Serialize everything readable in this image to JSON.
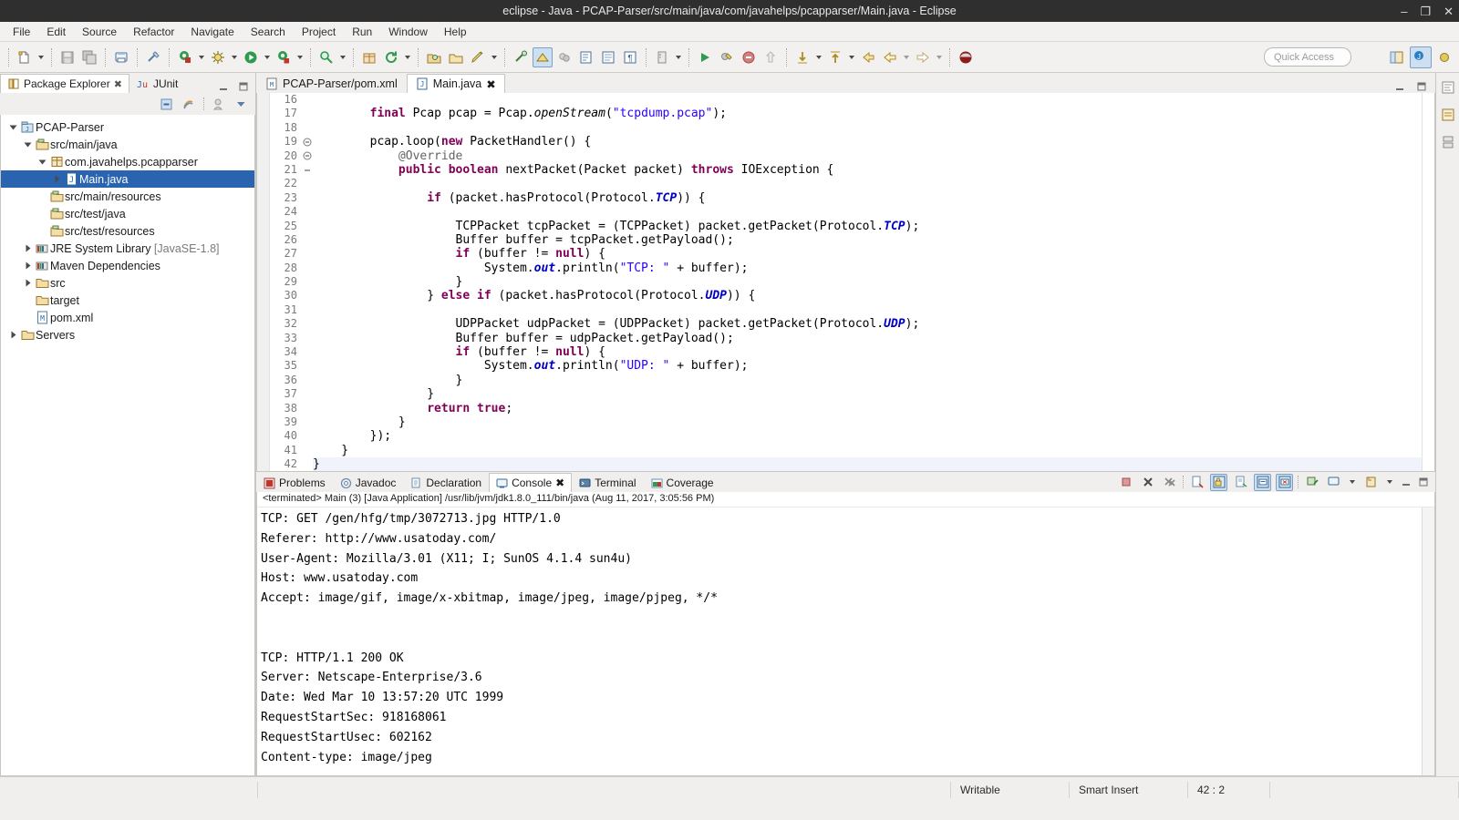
{
  "window": {
    "title": "eclipse - Java - PCAP-Parser/src/main/java/com/javahelps/pcapparser/Main.java - Eclipse",
    "minimize_label": "–",
    "maximize_label": "❐",
    "close_label": "✕"
  },
  "menubar": {
    "items": [
      {
        "label": "File"
      },
      {
        "label": "Edit"
      },
      {
        "label": "Source"
      },
      {
        "label": "Refactor"
      },
      {
        "label": "Navigate"
      },
      {
        "label": "Search"
      },
      {
        "label": "Project"
      },
      {
        "label": "Run"
      },
      {
        "label": "Window"
      },
      {
        "label": "Help"
      }
    ]
  },
  "toolbar": {
    "quick_access_placeholder": "Quick Access",
    "buttons": [
      {
        "name": "new-wizard",
        "icon": "new-file-icon"
      },
      {
        "name": "save",
        "icon": "save-icon"
      },
      {
        "name": "save-all",
        "icon": "save-all-icon"
      },
      {
        "name": "print",
        "icon": "print-icon"
      },
      {
        "name": "link-editor",
        "icon": "link-icon"
      },
      {
        "name": "new-java-class",
        "icon": "java-class-icon"
      },
      {
        "name": "debug",
        "icon": "debug-icon"
      },
      {
        "name": "run",
        "icon": "run-icon"
      },
      {
        "name": "run-external-tools",
        "icon": "external-tools-icon"
      },
      {
        "name": "search",
        "icon": "search-icon"
      },
      {
        "name": "new-package",
        "icon": "package-icon"
      },
      {
        "name": "refresh",
        "icon": "refresh-icon"
      },
      {
        "name": "open-type",
        "icon": "open-type-icon"
      },
      {
        "name": "open-task",
        "icon": "open-task-icon"
      },
      {
        "name": "annotation",
        "icon": "pencil-icon"
      },
      {
        "name": "toggle-mark-occurrences",
        "icon": "mark-occurrences-icon"
      },
      {
        "name": "toggle-breadcrumb",
        "icon": "breadcrumb-icon"
      },
      {
        "name": "coverage",
        "icon": "coverage-icon"
      },
      {
        "name": "next-annotation",
        "icon": "next-annotation-icon"
      },
      {
        "name": "previous-annotation",
        "icon": "previous-annotation-icon"
      },
      {
        "name": "last-edit-location",
        "icon": "last-edit-icon"
      },
      {
        "name": "back",
        "icon": "back-arrow-icon"
      },
      {
        "name": "forward",
        "icon": "forward-arrow-icon"
      },
      {
        "name": "terminate",
        "icon": "terminate-icon"
      }
    ],
    "perspectives": [
      {
        "name": "open-perspective",
        "icon": "open-perspective-icon"
      },
      {
        "name": "perspective-java",
        "icon": "java-perspective-icon",
        "selected": true
      },
      {
        "name": "perspective-debug",
        "icon": "debug-perspective-icon",
        "selected": false
      }
    ]
  },
  "package_explorer": {
    "tabs": [
      {
        "label": "Package Explorer",
        "icon": "package-explorer-icon",
        "selected": true,
        "closeable": true
      },
      {
        "label": "JUnit",
        "icon": "junit-icon",
        "selected": false,
        "closeable": false
      }
    ],
    "view_buttons": [
      {
        "name": "minimize-view-button",
        "icon": "minimize-icon"
      },
      {
        "name": "maximize-view-button",
        "icon": "maximize-icon"
      }
    ],
    "toolbar_buttons": [
      {
        "name": "collapse-all-button",
        "icon": "collapse-all-icon"
      },
      {
        "name": "link-with-editor-button",
        "icon": "link-with-editor-icon"
      },
      {
        "name": "focus-on-active-task-button",
        "icon": "focus-task-icon"
      },
      {
        "name": "view-menu-button",
        "icon": "view-menu-icon"
      }
    ],
    "tree": [
      {
        "label": "PCAP-Parser",
        "indent": 0,
        "twist": "open",
        "icon": "java-project-icon",
        "selected": false
      },
      {
        "label": "src/main/java",
        "indent": 1,
        "twist": "open",
        "icon": "source-folder-icon",
        "selected": false
      },
      {
        "label": "com.javahelps.pcapparser",
        "indent": 2,
        "twist": "open",
        "icon": "package-icon",
        "selected": false
      },
      {
        "label": "Main.java",
        "indent": 3,
        "twist": "closed",
        "icon": "java-file-icon",
        "selected": true
      },
      {
        "label": "src/main/resources",
        "indent": 2,
        "twist": "none",
        "icon": "source-folder-icon",
        "selected": false
      },
      {
        "label": "src/test/java",
        "indent": 2,
        "twist": "none",
        "icon": "source-folder-icon",
        "selected": false
      },
      {
        "label": "src/test/resources",
        "indent": 2,
        "twist": "none",
        "icon": "source-folder-icon",
        "selected": false
      },
      {
        "label": "JRE System Library",
        "suffix": "[JavaSE-1.8]",
        "indent": 1,
        "twist": "closed",
        "icon": "library-icon",
        "selected": false
      },
      {
        "label": "Maven Dependencies",
        "indent": 1,
        "twist": "closed",
        "icon": "library-icon",
        "selected": false
      },
      {
        "label": "src",
        "indent": 1,
        "twist": "closed",
        "icon": "folder-icon",
        "selected": false
      },
      {
        "label": "target",
        "indent": 1,
        "twist": "none",
        "icon": "folder-icon",
        "selected": false
      },
      {
        "label": "pom.xml",
        "indent": 1,
        "twist": "none",
        "icon": "xml-file-icon",
        "selected": false
      },
      {
        "label": "Servers",
        "indent": 0,
        "twist": "closed",
        "icon": "folder-icon",
        "selected": false
      }
    ]
  },
  "editor": {
    "tabs": [
      {
        "label": "PCAP-Parser/pom.xml",
        "icon": "xml-file-icon",
        "selected": false,
        "closeable": false
      },
      {
        "label": "Main.java",
        "icon": "java-file-icon",
        "selected": true,
        "closeable": true
      }
    ],
    "tab_buttons": [
      {
        "name": "minimize-editor-button",
        "icon": "minimize-icon"
      },
      {
        "name": "maximize-editor-button",
        "icon": "maximize-icon"
      }
    ],
    "first_line": 16,
    "lines": [
      {
        "n": 16,
        "fold": "",
        "text": ""
      },
      {
        "n": 17,
        "fold": "",
        "html": "        <span class=\"kw\">final</span> Pcap pcap = Pcap.<span class=\"stat\">openStream</span>(<span class=\"str\">\"tcpdump.pcap\"</span>);"
      },
      {
        "n": 18,
        "fold": "",
        "text": ""
      },
      {
        "n": 19,
        "fold": "minus",
        "html": "        pcap.loop(<span class=\"kw\">new</span> PacketHandler() {"
      },
      {
        "n": 20,
        "fold": "minus",
        "html": "            <span class=\"ann\">@Override</span>"
      },
      {
        "n": 21,
        "fold": "dash",
        "html": "            <span class=\"kw\">public</span> <span class=\"kw\">boolean</span> nextPacket(Packet packet) <span class=\"kw\">throws</span> IOException {"
      },
      {
        "n": 22,
        "fold": "",
        "text": ""
      },
      {
        "n": 23,
        "fold": "",
        "html": "                <span class=\"kw\">if</span> (packet.hasProtocol(Protocol.<span class=\"statb\">TCP</span>)) {"
      },
      {
        "n": 24,
        "fold": "",
        "text": ""
      },
      {
        "n": 25,
        "fold": "",
        "html": "                    TCPPacket tcpPacket = (TCPPacket) packet.getPacket(Protocol.<span class=\"statb\">TCP</span>);"
      },
      {
        "n": 26,
        "fold": "",
        "html": "                    Buffer buffer = tcpPacket.getPayload();"
      },
      {
        "n": 27,
        "fold": "",
        "html": "                    <span class=\"kw\">if</span> (buffer != <span class=\"kw\">null</span>) {"
      },
      {
        "n": 28,
        "fold": "",
        "html": "                        System.<span class=\"statb\">out</span>.println(<span class=\"str\">\"TCP: \"</span> + buffer);"
      },
      {
        "n": 29,
        "fold": "",
        "html": "                    }"
      },
      {
        "n": 30,
        "fold": "",
        "html": "                } <span class=\"kw\">else</span> <span class=\"kw\">if</span> (packet.hasProtocol(Protocol.<span class=\"statb\">UDP</span>)) {"
      },
      {
        "n": 31,
        "fold": "",
        "text": ""
      },
      {
        "n": 32,
        "fold": "",
        "html": "                    UDPPacket udpPacket = (UDPPacket) packet.getPacket(Protocol.<span class=\"statb\">UDP</span>);"
      },
      {
        "n": 33,
        "fold": "",
        "html": "                    Buffer buffer = udpPacket.getPayload();"
      },
      {
        "n": 34,
        "fold": "",
        "html": "                    <span class=\"kw\">if</span> (buffer != <span class=\"kw\">null</span>) {"
      },
      {
        "n": 35,
        "fold": "",
        "html": "                        System.<span class=\"statb\">out</span>.println(<span class=\"str\">\"UDP: \"</span> + buffer);"
      },
      {
        "n": 36,
        "fold": "",
        "html": "                    }"
      },
      {
        "n": 37,
        "fold": "",
        "html": "                }"
      },
      {
        "n": 38,
        "fold": "",
        "html": "                <span class=\"kw\">return</span> <span class=\"kw\">true</span>;"
      },
      {
        "n": 39,
        "fold": "",
        "html": "            }"
      },
      {
        "n": 40,
        "fold": "",
        "html": "        });"
      },
      {
        "n": 41,
        "fold": "",
        "html": "    }"
      },
      {
        "n": 42,
        "fold": "",
        "html": "}",
        "current": true
      }
    ]
  },
  "console": {
    "tabs": [
      {
        "label": "Problems",
        "icon": "problems-icon",
        "selected": false,
        "closeable": false
      },
      {
        "label": "Javadoc",
        "icon": "javadoc-icon",
        "selected": false,
        "closeable": false
      },
      {
        "label": "Declaration",
        "icon": "declaration-icon",
        "selected": false,
        "closeable": false
      },
      {
        "label": "Console",
        "icon": "console-icon",
        "selected": true,
        "closeable": true
      },
      {
        "label": "Terminal",
        "icon": "terminal-icon",
        "selected": false,
        "closeable": false
      },
      {
        "label": "Coverage",
        "icon": "coverage-icon",
        "selected": false,
        "closeable": false
      }
    ],
    "toolbar_buttons": [
      {
        "name": "terminate-button",
        "icon": "terminate-icon",
        "active": false
      },
      {
        "name": "remove-launch-button",
        "icon": "remove-icon",
        "active": false
      },
      {
        "name": "remove-all-terminated-button",
        "icon": "remove-all-icon",
        "active": false
      },
      {
        "name": "clear-console-button",
        "icon": "clear-console-icon",
        "active": false
      },
      {
        "name": "scroll-lock-button",
        "icon": "scroll-lock-icon",
        "active": true
      },
      {
        "name": "word-wrap-button",
        "icon": "word-wrap-icon",
        "active": false
      },
      {
        "name": "show-console-on-output-button",
        "icon": "show-on-output-icon",
        "active": true
      },
      {
        "name": "show-console-on-error-button",
        "icon": "show-on-error-icon",
        "active": true
      },
      {
        "name": "pin-console-button",
        "icon": "pin-icon",
        "active": false
      },
      {
        "name": "display-selected-console-button",
        "icon": "display-console-icon",
        "active": false
      },
      {
        "name": "open-console-button",
        "icon": "open-console-icon",
        "active": false
      },
      {
        "name": "minimize-console-button",
        "icon": "minimize-icon",
        "active": false
      },
      {
        "name": "maximize-console-button",
        "icon": "maximize-icon",
        "active": false
      }
    ],
    "launch_header": "<terminated> Main (3) [Java Application] /usr/lib/jvm/jdk1.8.0_111/bin/java (Aug 11, 2017, 3:05:56 PM)",
    "output": [
      "TCP: GET /gen/hfg/tmp/3072713.jpg HTTP/1.0",
      "Referer: http://www.usatoday.com/",
      "User-Agent: Mozilla/3.01 (X11; I; SunOS 4.1.4 sun4u)",
      "Host: www.usatoday.com",
      "Accept: image/gif, image/x-xbitmap, image/jpeg, image/pjpeg, */*",
      "",
      "",
      "TCP: HTTP/1.1 200 OK",
      "Server: Netscape-Enterprise/3.6",
      "Date: Wed Mar 10 13:57:20 UTC 1999",
      "RequestStartSec: 918168061",
      "RequestStartUsec: 602162",
      "Content-type: image/jpeg"
    ]
  },
  "statusbar": {
    "writable": "Writable",
    "insert_mode": "Smart Insert",
    "cursor_position": "42 : 2"
  },
  "fastview": {
    "buttons": [
      {
        "name": "fastview-outline-button",
        "icon": "outline-icon"
      },
      {
        "name": "fastview-task-list-button",
        "icon": "task-list-icon"
      },
      {
        "name": "fastview-servers-button",
        "icon": "servers-icon"
      }
    ]
  },
  "colors": {
    "selection_blue": "#2a63b0",
    "keyword_purple": "#7f0055",
    "string_blue": "#2a00ff",
    "titlebar_dark": "#2f2f2f",
    "chrome_gray": "#f0efee"
  }
}
